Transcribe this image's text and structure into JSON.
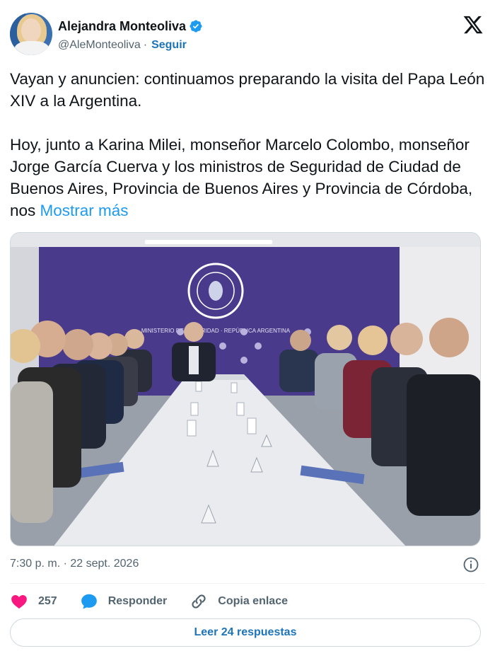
{
  "author": {
    "display_name": "Alejandra Monteoliva",
    "handle": "@AleMonteoliva",
    "separator": "·",
    "follow_label": "Seguir",
    "verified": true
  },
  "tweet": {
    "text": "Vayan y anuncien: continuamos preparando la visita del Papa León XIV a la Argentina.\n\nHoy, junto a Karina Milei, monseñor Marcelo Colombo, monseñor Jorge García Cuerva y los ministros de Seguridad de Ciudad de Buenos Aires, Provincia de Buenos Aires y Provincia de Córdoba, nos ",
    "show_more_label": "Mostrar más"
  },
  "photo": {
    "wall_logo_text": "MINISTERIO DE SEGURIDAD · REPÚBLICA ARGENTINA",
    "wall_label": "Ministerio de Seguridad"
  },
  "meta": {
    "timestamp": "7:30 p. m. · 22 sept. 2026"
  },
  "actions": {
    "likes": "257",
    "reply_label": "Responder",
    "copy_link_label": "Copia enlace"
  },
  "read_replies_label": "Leer 24 respuestas",
  "icons": {
    "verified": "verified-badge-icon",
    "x_logo": "x-logo-icon",
    "info": "info-icon",
    "heart": "heart-icon",
    "reply": "reply-bubble-icon",
    "link": "link-icon"
  },
  "colors": {
    "accent": "#1d9bf0",
    "link_dark": "#1d74b8",
    "heart": "#f91880",
    "text": "#0f1419",
    "muted": "#536471",
    "wall_purple": "#4a3a8c"
  }
}
